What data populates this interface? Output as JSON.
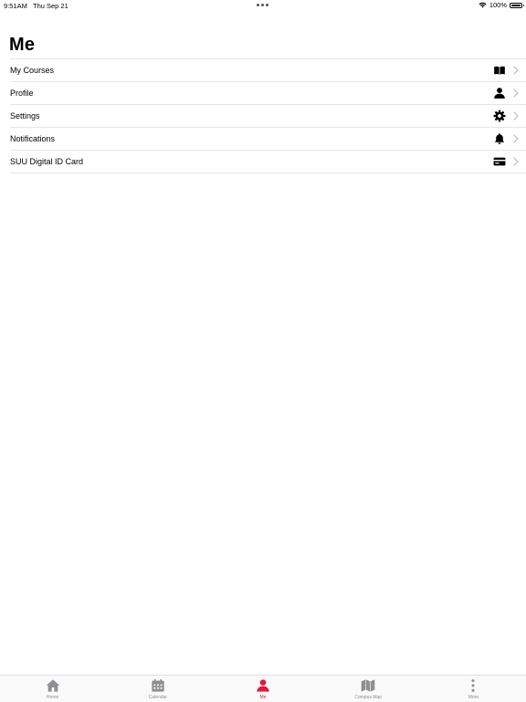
{
  "status_bar": {
    "time": "9:51AM",
    "date": "Thu Sep 21",
    "battery": "100%",
    "battery_level": 1.0,
    "wifi_icon": "wifi-icon"
  },
  "page": {
    "title": "Me"
  },
  "menu": {
    "items": [
      {
        "label": "My Courses",
        "icon": "book-icon"
      },
      {
        "label": "Profile",
        "icon": "person-icon"
      },
      {
        "label": "Settings",
        "icon": "gear-icon"
      },
      {
        "label": "Notifications",
        "icon": "bell-icon"
      },
      {
        "label": "SUU Digital ID Card",
        "icon": "id-card-icon"
      }
    ]
  },
  "tab_bar": {
    "active_color": "#e31837",
    "inactive_color": "#8e8e93",
    "tabs": [
      {
        "label": "Home",
        "icon": "home-icon"
      },
      {
        "label": "Calendar",
        "icon": "calendar-icon"
      },
      {
        "label": "Me",
        "icon": "person-icon",
        "active": true
      },
      {
        "label": "Campus Map",
        "icon": "map-icon"
      },
      {
        "label": "More",
        "icon": "more-vertical-icon"
      }
    ]
  }
}
